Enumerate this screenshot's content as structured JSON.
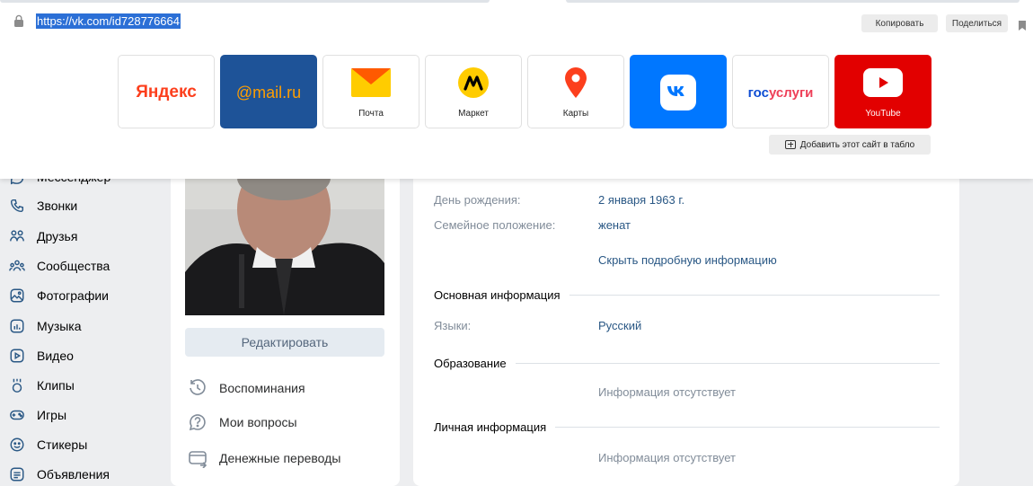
{
  "browser": {
    "url": "https://vk.com/id728776664",
    "copy_label": "Копировать",
    "share_label": "Поделиться",
    "add_site_label": "Добавить этот сайт в табло",
    "tiles": [
      {
        "name": "yandex",
        "logo_text": "Яндекс",
        "caption": ""
      },
      {
        "name": "mail",
        "logo_text": "@mail.ru",
        "caption": ""
      },
      {
        "name": "pochta",
        "logo_text": "",
        "caption": "Почта"
      },
      {
        "name": "market",
        "logo_text": "",
        "caption": "Маркет"
      },
      {
        "name": "karty",
        "logo_text": "",
        "caption": "Карты"
      },
      {
        "name": "vk",
        "logo_text": "",
        "caption": ""
      },
      {
        "name": "gosuslugi",
        "logo_text_1": "гос",
        "logo_text_2": "услуги",
        "caption": ""
      },
      {
        "name": "youtube",
        "logo_text": "",
        "caption": "YouTube"
      }
    ]
  },
  "nav": {
    "items": [
      {
        "label": "Мессенджер",
        "icon": "messenger-icon"
      },
      {
        "label": "Звонки",
        "icon": "phone-icon"
      },
      {
        "label": "Друзья",
        "icon": "friends-icon"
      },
      {
        "label": "Сообщества",
        "icon": "communities-icon"
      },
      {
        "label": "Фотографии",
        "icon": "photos-icon"
      },
      {
        "label": "Музыка",
        "icon": "music-icon"
      },
      {
        "label": "Видео",
        "icon": "video-icon"
      },
      {
        "label": "Клипы",
        "icon": "clips-icon"
      },
      {
        "label": "Игры",
        "icon": "games-icon"
      },
      {
        "label": "Стикеры",
        "icon": "stickers-icon"
      },
      {
        "label": "Объявления",
        "icon": "ads-icon"
      }
    ]
  },
  "profile": {
    "edit_label": "Редактировать",
    "links": [
      {
        "label": "Воспоминания",
        "icon": "memories-icon"
      },
      {
        "label": "Мои вопросы",
        "icon": "question-icon"
      },
      {
        "label": "Денежные переводы",
        "icon": "transfer-icon"
      }
    ]
  },
  "info": {
    "birthday_key": "День рождения:",
    "birthday_value": "2 января 1963 г.",
    "family_key": "Семейное положение:",
    "family_value": "женат",
    "hide_details": "Скрыть подробную информацию",
    "main_section": "Основная информация",
    "languages_key": "Языки:",
    "languages_value": "Русский",
    "education_section": "Образование",
    "education_value": "Информация отсутствует",
    "personal_section": "Личная информация",
    "personal_value": "Информация отсутствует"
  },
  "colors": {
    "vk_link": "#2a5885",
    "url_highlight": "#2b6fd6",
    "vk_blue": "#0077ff",
    "youtube_red": "#e20000",
    "mail_blue": "#1e5398"
  }
}
